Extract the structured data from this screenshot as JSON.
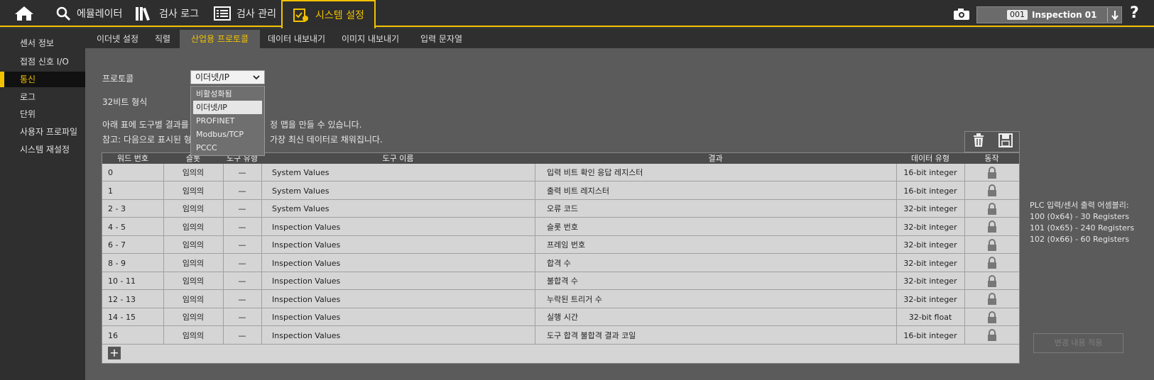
{
  "nav": {
    "items": [
      {
        "label": "에뮬레이터"
      },
      {
        "label": "검사 로그"
      },
      {
        "label": "검사 관리"
      },
      {
        "label": "시스템 설정"
      }
    ],
    "inspection_number": "001",
    "inspection_name": "Inspection 01",
    "help": "?"
  },
  "sidebar": {
    "items": [
      {
        "label": "센서 정보"
      },
      {
        "label": "접점 신호 I/O"
      },
      {
        "label": "통신"
      },
      {
        "label": "로그"
      },
      {
        "label": "단위"
      },
      {
        "label": "사용자 프로파일"
      },
      {
        "label": "시스템 재설정"
      }
    ]
  },
  "subtabs": [
    {
      "label": "이더넷 설정"
    },
    {
      "label": "직렬"
    },
    {
      "label": "산업용 프로토콜"
    },
    {
      "label": "데이터 내보내기"
    },
    {
      "label": "이미지 내보내기"
    },
    {
      "label": "입력 문자열"
    }
  ],
  "form": {
    "protocol_label": "프로토콜",
    "protocol_value": "이더넷/IP",
    "bit32_label": "32비트 형식",
    "desc1": "아래 표에 도구별 결과를",
    "desc1_tail": "정 맵을 만들 수 있습니다.",
    "desc2": "참고: 다음으로 표시된 형",
    "desc2_tail": "가장 최신 데이터로 채워집니다."
  },
  "dropdown": {
    "options": [
      {
        "label": "비활성화됨"
      },
      {
        "label": "이더넷/IP"
      },
      {
        "label": "PROFINET"
      },
      {
        "label": "Modbus/TCP"
      },
      {
        "label": "PCCC"
      }
    ]
  },
  "table": {
    "headers": [
      "워드 번호",
      "슬롯",
      "도구 유형",
      "도구 이름",
      "결과",
      "데이터 유형",
      "동작"
    ],
    "rows": [
      {
        "word": "0",
        "slot": "임의의",
        "tool_type": "—",
        "tool_name": "System Values",
        "result": "입력 비트 확인 응답 레지스터",
        "dtype": "16-bit integer"
      },
      {
        "word": "1",
        "slot": "임의의",
        "tool_type": "—",
        "tool_name": "System Values",
        "result": "출력 비트 레지스터",
        "dtype": "16-bit integer"
      },
      {
        "word": "2 - 3",
        "slot": "임의의",
        "tool_type": "—",
        "tool_name": "System Values",
        "result": "오류 코드",
        "dtype": "32-bit integer"
      },
      {
        "word": "4 - 5",
        "slot": "임의의",
        "tool_type": "—",
        "tool_name": "Inspection Values",
        "result": "슬롯 번호",
        "dtype": "32-bit integer"
      },
      {
        "word": "6 - 7",
        "slot": "임의의",
        "tool_type": "—",
        "tool_name": "Inspection Values",
        "result": "프레임 번호",
        "dtype": "32-bit integer"
      },
      {
        "word": "8 - 9",
        "slot": "임의의",
        "tool_type": "—",
        "tool_name": "Inspection Values",
        "result": "합격 수",
        "dtype": "32-bit integer"
      },
      {
        "word": "10 - 11",
        "slot": "임의의",
        "tool_type": "—",
        "tool_name": "Inspection Values",
        "result": "불합격 수",
        "dtype": "32-bit integer"
      },
      {
        "word": "12 - 13",
        "slot": "임의의",
        "tool_type": "—",
        "tool_name": "Inspection Values",
        "result": "누락된 트리거 수",
        "dtype": "32-bit integer"
      },
      {
        "word": "14 - 15",
        "slot": "임의의",
        "tool_type": "—",
        "tool_name": "Inspection Values",
        "result": "실행 시간",
        "dtype": "32-bit float"
      },
      {
        "word": "16",
        "slot": "임의의",
        "tool_type": "—",
        "tool_name": "Inspection Values",
        "result": "도구 합격 불합격 결과 코일",
        "dtype": "16-bit integer"
      }
    ],
    "add_label": "+"
  },
  "plc": {
    "title": "PLC 입력/센서 출력 어셈블리:",
    "lines": [
      "100 (0x64) - 30 Registers",
      "101 (0x65) - 240 Registers",
      "102 (0x66) - 60 Registers"
    ]
  },
  "apply_label": "변경 내용 적용",
  "colors": {
    "accent": "#f2c200",
    "bg": "#5b5b5b",
    "dark": "#2e2e2e"
  }
}
